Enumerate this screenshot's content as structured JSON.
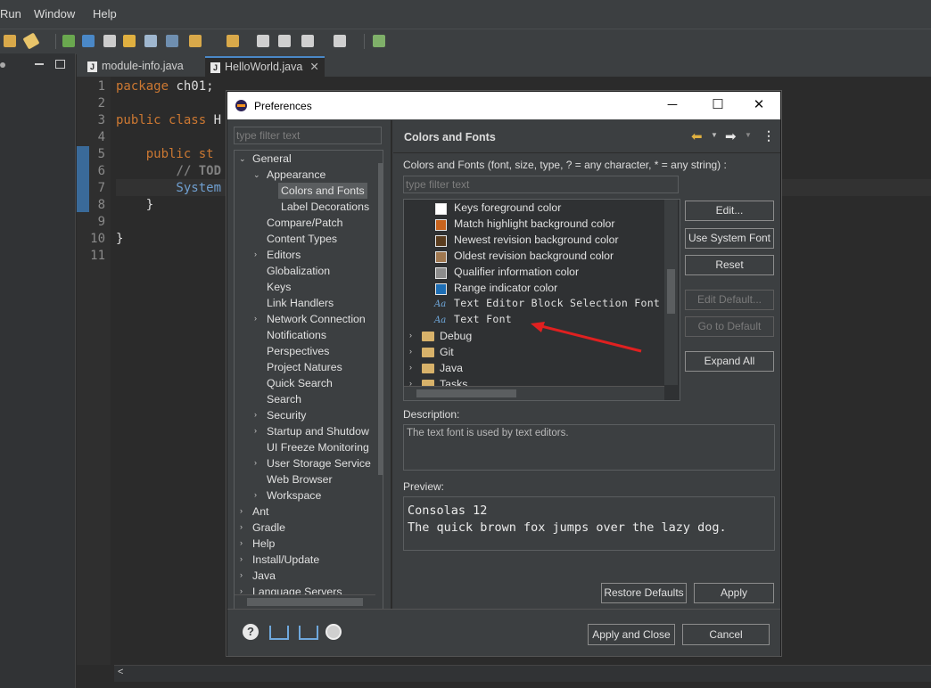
{
  "menubar": {
    "items": [
      "Run",
      "Window",
      "Help"
    ]
  },
  "editor": {
    "tabs": [
      {
        "label": "module-info.java",
        "active": false
      },
      {
        "label": "HelloWorld.java",
        "active": true
      }
    ],
    "line_numbers": [
      "1",
      "2",
      "3",
      "4",
      "5",
      "6",
      "7",
      "8",
      "9",
      "10",
      "11"
    ],
    "code_lines": {
      "l1a": "package",
      "l1b": " ch01;",
      "l3a": "public class",
      "l3b": " H",
      "l5a": "    public st",
      "l6a": "        // TOD",
      "l7a": "        System",
      "l8a": "    }",
      "l10a": "}"
    }
  },
  "dialog": {
    "title": "Preferences",
    "filter_placeholder": "type filter text",
    "tree": {
      "items": [
        {
          "label": "General",
          "expanded": true
        },
        {
          "label": "Appearance",
          "expanded": true
        },
        {
          "label": "Colors and Fonts",
          "selected": true
        },
        {
          "label": "Label Decorations"
        },
        {
          "label": "Compare/Patch"
        },
        {
          "label": "Content Types"
        },
        {
          "label": "Editors"
        },
        {
          "label": "Globalization"
        },
        {
          "label": "Keys"
        },
        {
          "label": "Link Handlers"
        },
        {
          "label": "Network Connection"
        },
        {
          "label": "Notifications"
        },
        {
          "label": "Perspectives"
        },
        {
          "label": "Project Natures"
        },
        {
          "label": "Quick Search"
        },
        {
          "label": "Search"
        },
        {
          "label": "Security"
        },
        {
          "label": "Startup and Shutdow"
        },
        {
          "label": "UI Freeze Monitoring"
        },
        {
          "label": "User Storage Service"
        },
        {
          "label": "Web Browser"
        },
        {
          "label": "Workspace"
        },
        {
          "label": "Ant"
        },
        {
          "label": "Gradle"
        },
        {
          "label": "Help"
        },
        {
          "label": "Install/Update"
        },
        {
          "label": "Java"
        },
        {
          "label": "Language Servers"
        }
      ]
    },
    "page": {
      "title": "Colors and Fonts",
      "description_line": "Colors and Fonts (font, size, type, ? = any character, * = any string) :",
      "filter_placeholder": "type filter text",
      "color_items": [
        {
          "label": "Keys foreground color",
          "color": "#ffffff"
        },
        {
          "label": "Match highlight background color",
          "color": "#c8641e"
        },
        {
          "label": "Newest revision background color",
          "color": "#5a3c1e"
        },
        {
          "label": "Oldest revision background color",
          "color": "#a07850"
        },
        {
          "label": "Qualifier information color",
          "color": "#8c8c8c"
        },
        {
          "label": "Range indicator color",
          "color": "#1e6eb4"
        }
      ],
      "font_items": [
        {
          "label": "Text Editor Block Selection Font",
          "icon": "Aa"
        },
        {
          "label": "Text Font",
          "icon": "Aa"
        }
      ],
      "category_items": [
        "Debug",
        "Git",
        "Java",
        "Tasks"
      ],
      "buttons": {
        "edit": "Edit...",
        "use_system_font": "Use System Font",
        "reset": "Reset",
        "edit_default": "Edit Default...",
        "go_to_default": "Go to Default",
        "expand_all": "Expand All"
      },
      "description_label": "Description:",
      "description_text": "The text font is used by text editors.",
      "preview_label": "Preview:",
      "preview_line1": "Consolas 12",
      "preview_line2": "The quick brown fox jumps over the lazy dog.",
      "restore_defaults": "Restore Defaults",
      "apply": "Apply"
    },
    "footer": {
      "apply_and_close": "Apply and Close",
      "cancel": "Cancel"
    },
    "annotation_color": "#e02020"
  }
}
